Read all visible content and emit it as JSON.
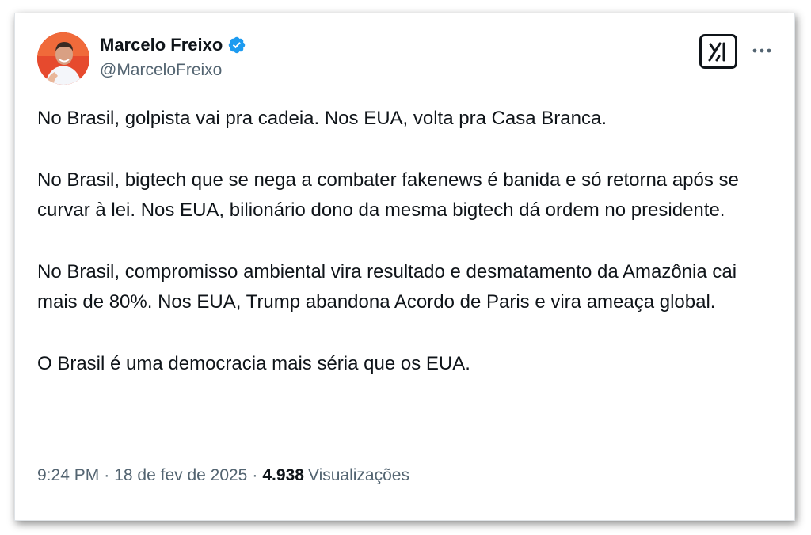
{
  "author": {
    "display_name": "Marcelo Freixo",
    "handle": "@MarceloFreixo",
    "verified": true,
    "verified_color": "#1d9bf0"
  },
  "header_actions": {
    "grok_icon": "grok-icon",
    "more_icon": "more-horizontal-icon"
  },
  "tweet": {
    "paragraphs": [
      "No Brasil, golpista vai pra cadeia. Nos EUA, volta pra Casa Branca.",
      "No Brasil, bigtech que se nega a combater fakenews é banida e só retorna após se curvar à lei. Nos EUA, bilionário dono da mesma bigtech dá ordem no presidente.",
      "No Brasil, compromisso ambiental vira resultado e desmatamento da Amazônia cai mais de 80%. Nos EUA, Trump abandona Acordo de Paris e vira ameaça global.",
      "O Brasil é uma democracia mais séria que os EUA."
    ]
  },
  "meta": {
    "time": "9:24 PM",
    "separator": "·",
    "date": "18 de fev de 2025",
    "views_count": "4.938",
    "views_label": "Visualizações"
  },
  "colors": {
    "text_primary": "#0f1419",
    "text_secondary": "#536471",
    "avatar_bg": "#e8452c"
  }
}
